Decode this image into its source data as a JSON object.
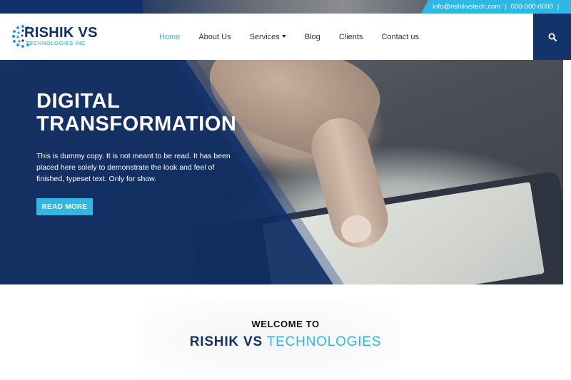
{
  "topbar": {
    "email": "info@rishikvstech.com",
    "separator": "|",
    "phone": "000-000-0000",
    "trailing_separator": "|"
  },
  "logo": {
    "name": "RISHIK VS",
    "subtitle": "TECHNOLOGIES INC"
  },
  "nav": {
    "items": [
      {
        "label": "Home",
        "active": true
      },
      {
        "label": "About Us"
      },
      {
        "label": "Services",
        "dropdown": true
      },
      {
        "label": "Blog"
      },
      {
        "label": "Clients"
      },
      {
        "label": "Contact us"
      }
    ]
  },
  "search": {
    "icon": "search-icon"
  },
  "hero": {
    "title_line1": "DIGITAL",
    "title_line2": "TRANSFORMATION",
    "text": "This is dummy copy. It is not meant to be read. It has been placed here solely to demonstrate the look and feel of finished, typeset text. Only for show.",
    "button_label": "READ MORE"
  },
  "welcome": {
    "subtitle": "WELCOME TO",
    "title_strong": "RISHIK VS",
    "title_light": "TECHNOLOGIES"
  },
  "colors": {
    "brand_navy": "#12306a",
    "accent_blue": "#2eb8e6"
  }
}
